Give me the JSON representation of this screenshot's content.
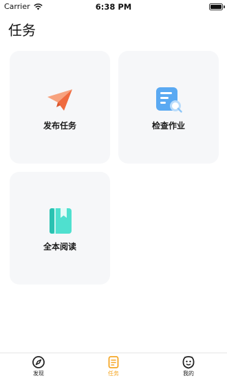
{
  "status_bar": {
    "carrier": "Carrier",
    "time": "6:38 PM"
  },
  "page": {
    "title": "任务"
  },
  "cards": [
    {
      "label": "发布任务",
      "icon": "paper-plane-icon",
      "color": "#f0764a"
    },
    {
      "label": "检查作业",
      "icon": "document-check-icon",
      "color": "#4a9ef0"
    },
    {
      "label": "全本阅读",
      "icon": "book-icon",
      "color": "#3fd9c8"
    }
  ],
  "tab_bar": {
    "active_color": "#f5a623",
    "items": [
      {
        "label": "发现",
        "icon": "compass-icon",
        "active": false
      },
      {
        "label": "任务",
        "icon": "task-list-icon",
        "active": true
      },
      {
        "label": "我的",
        "icon": "profile-face-icon",
        "active": false
      }
    ]
  }
}
